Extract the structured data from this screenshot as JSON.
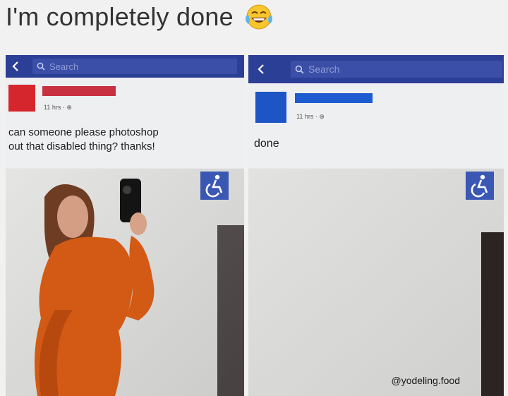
{
  "title": "I'm completely done",
  "left_post": {
    "search_placeholder": "Search",
    "meta": "11 hrs · ⊕",
    "caption_line1": "can someone please photoshop",
    "caption_line2": "out that disabled thing? thanks!"
  },
  "right_post": {
    "search_placeholder": "Search",
    "meta": "11 hrs · ⊕",
    "caption": "done",
    "credit": "@yodeling.food"
  },
  "colors": {
    "facebook_blue": "#2c3f97",
    "left_avatar": "#d4262c",
    "right_avatar": "#1d55c7",
    "accessible_icon_bg": "#3a57b4"
  },
  "icons": [
    "laughing-crying-emoji-icon",
    "back-arrow-icon",
    "search-icon",
    "accessible-symbol-icon"
  ]
}
